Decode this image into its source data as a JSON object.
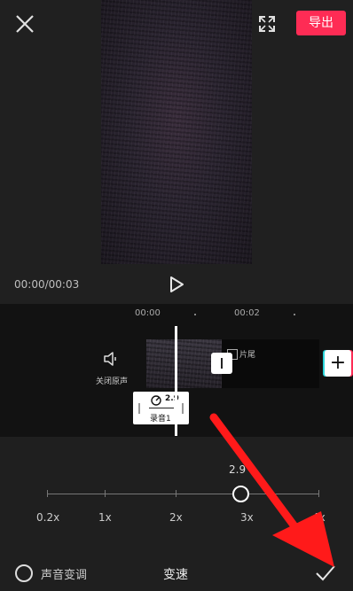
{
  "header": {
    "export_label": "导出"
  },
  "player": {
    "time": "00:00/00:03"
  },
  "timeline": {
    "ruler": [
      "00:00",
      "00:02"
    ],
    "mute_label": "关闭原声",
    "tail_label": "片尾",
    "audio_clip": {
      "speed": "2.9",
      "label": "录音1"
    }
  },
  "speed_slider": {
    "current_value": "2.9",
    "labels": [
      "0.2x",
      "1x",
      "2x",
      "3x",
      "4x"
    ]
  },
  "bottom_bar": {
    "voice_change_label": "声音变调",
    "title": "变速"
  },
  "colors": {
    "accent": "#fe2c55",
    "annotation": "#ff1a1a"
  },
  "icons": [
    "close-icon",
    "fullscreen-icon",
    "play-icon",
    "mute-icon",
    "add-icon",
    "speed-icon",
    "check-icon"
  ]
}
